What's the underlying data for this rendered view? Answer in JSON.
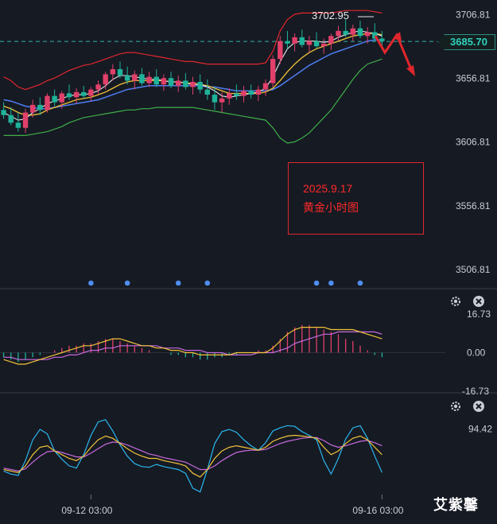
{
  "symbol_note": {
    "date": "2025.9.17",
    "text": "黄金小时图"
  },
  "watermark": "艾紫馨",
  "price_badge": "3685.70",
  "high_marker": "3702.95",
  "colors": {
    "up": "#e0406a",
    "down": "#1fb39a",
    "ma_fast": "#e8e8e8",
    "ma_mid": "#f2c33a",
    "ma_slow": "#4f7df2",
    "boll_upper": "#e0262d",
    "boll_lower": "#3fae4a",
    "macd_dif": "#f2c33a",
    "macd_dea": "#c86ae0",
    "kdj_k": "#f2c33a",
    "kdj_d": "#c86ae0",
    "kdj_j": "#2bb7f0",
    "annotation": "#ff2a2a",
    "dots": "#4f8df2"
  },
  "chart_data": [
    {
      "type": "candlestick",
      "title": "",
      "ylim": [
        3500,
        3712
      ],
      "y_ticks": [
        "3706.81",
        "3656.81",
        "3606.81",
        "3556.81",
        "3506.81"
      ],
      "y_tick_values": [
        3706.81,
        3656.81,
        3606.81,
        3556.81,
        3506.81
      ],
      "x_ticks": [
        "09-12 03:00",
        "09-16 03:00"
      ],
      "x_tick_index": [
        12,
        52
      ],
      "current_price": 3685.7,
      "high_marker": 3702.95,
      "candles": [
        [
          3632,
          3638,
          3625,
          3628
        ],
        [
          3628,
          3634,
          3620,
          3622
        ],
        [
          3622,
          3630,
          3615,
          3618
        ],
        [
          3618,
          3633,
          3614,
          3630
        ],
        [
          3630,
          3640,
          3626,
          3636
        ],
        [
          3636,
          3642,
          3628,
          3632
        ],
        [
          3632,
          3645,
          3630,
          3643
        ],
        [
          3643,
          3648,
          3635,
          3638
        ],
        [
          3638,
          3647,
          3633,
          3645
        ],
        [
          3645,
          3652,
          3640,
          3642
        ],
        [
          3642,
          3649,
          3637,
          3646
        ],
        [
          3646,
          3651,
          3641,
          3643
        ],
        [
          3643,
          3650,
          3639,
          3648
        ],
        [
          3648,
          3655,
          3644,
          3652
        ],
        [
          3652,
          3662,
          3648,
          3660
        ],
        [
          3660,
          3668,
          3655,
          3664
        ],
        [
          3664,
          3670,
          3657,
          3659
        ],
        [
          3659,
          3666,
          3652,
          3655
        ],
        [
          3655,
          3663,
          3648,
          3660
        ],
        [
          3660,
          3665,
          3651,
          3653
        ],
        [
          3653,
          3662,
          3650,
          3658
        ],
        [
          3658,
          3664,
          3650,
          3652
        ],
        [
          3652,
          3660,
          3647,
          3657
        ],
        [
          3657,
          3662,
          3649,
          3651
        ],
        [
          3651,
          3659,
          3646,
          3655
        ],
        [
          3655,
          3661,
          3648,
          3650
        ],
        [
          3650,
          3658,
          3644,
          3654
        ],
        [
          3654,
          3660,
          3645,
          3648
        ],
        [
          3648,
          3656,
          3640,
          3644
        ],
        [
          3644,
          3650,
          3632,
          3638
        ],
        [
          3638,
          3646,
          3630,
          3641
        ],
        [
          3641,
          3649,
          3636,
          3645
        ],
        [
          3645,
          3652,
          3640,
          3643
        ],
        [
          3643,
          3651,
          3638,
          3647
        ],
        [
          3647,
          3652,
          3641,
          3644
        ],
        [
          3644,
          3651,
          3639,
          3648
        ],
        [
          3648,
          3656,
          3643,
          3653
        ],
        [
          3653,
          3675,
          3650,
          3672
        ],
        [
          3672,
          3690,
          3668,
          3686
        ],
        [
          3686,
          3694,
          3680,
          3684
        ],
        [
          3684,
          3692,
          3678,
          3689
        ],
        [
          3689,
          3695,
          3681,
          3683
        ],
        [
          3683,
          3690,
          3677,
          3686
        ],
        [
          3686,
          3693,
          3680,
          3682
        ],
        [
          3682,
          3688,
          3676,
          3684
        ],
        [
          3684,
          3692,
          3679,
          3690
        ],
        [
          3690,
          3698,
          3686,
          3694
        ],
        [
          3694,
          3703,
          3689,
          3691
        ],
        [
          3691,
          3699,
          3686,
          3696
        ],
        [
          3696,
          3702,
          3688,
          3690
        ],
        [
          3690,
          3697,
          3684,
          3693
        ],
        [
          3693,
          3700,
          3686,
          3688
        ],
        [
          3688,
          3694,
          3681,
          3686
        ]
      ],
      "ma_fast": [
        3630,
        3627,
        3624,
        3625,
        3630,
        3633,
        3637,
        3639,
        3641,
        3643,
        3644,
        3644,
        3645,
        3647,
        3651,
        3656,
        3659,
        3659,
        3658,
        3657,
        3656,
        3656,
        3655,
        3654,
        3654,
        3653,
        3652,
        3652,
        3650,
        3647,
        3643,
        3642,
        3643,
        3644,
        3645,
        3646,
        3649,
        3658,
        3670,
        3680,
        3685,
        3686,
        3686,
        3686,
        3685,
        3686,
        3689,
        3691,
        3693,
        3694,
        3693,
        3692,
        3690
      ],
      "ma_mid": [
        3635,
        3633,
        3630,
        3628,
        3628,
        3629,
        3632,
        3634,
        3636,
        3638,
        3640,
        3641,
        3642,
        3644,
        3646,
        3649,
        3652,
        3654,
        3655,
        3655,
        3655,
        3655,
        3655,
        3654,
        3654,
        3653,
        3653,
        3652,
        3651,
        3649,
        3647,
        3645,
        3645,
        3645,
        3645,
        3645,
        3646,
        3649,
        3655,
        3662,
        3668,
        3673,
        3677,
        3680,
        3682,
        3684,
        3686,
        3688,
        3690,
        3691,
        3692,
        3692,
        3691
      ],
      "ma_slow": [
        3640,
        3639,
        3637,
        3635,
        3634,
        3633,
        3633,
        3634,
        3635,
        3636,
        3637,
        3638,
        3639,
        3640,
        3642,
        3644,
        3646,
        3648,
        3649,
        3650,
        3651,
        3651,
        3651,
        3651,
        3651,
        3651,
        3651,
        3651,
        3650,
        3650,
        3649,
        3648,
        3647,
        3647,
        3647,
        3647,
        3647,
        3648,
        3651,
        3655,
        3659,
        3663,
        3667,
        3670,
        3673,
        3676,
        3678,
        3680,
        3682,
        3684,
        3686,
        3687,
        3687
      ],
      "boll_upper": [
        3658,
        3655,
        3650,
        3648,
        3650,
        3652,
        3655,
        3657,
        3660,
        3663,
        3665,
        3667,
        3668,
        3670,
        3672,
        3674,
        3676,
        3677,
        3677,
        3676,
        3675,
        3674,
        3673,
        3672,
        3671,
        3670,
        3670,
        3669,
        3668,
        3668,
        3668,
        3668,
        3668,
        3668,
        3668,
        3668,
        3669,
        3678,
        3694,
        3703,
        3707,
        3708,
        3708,
        3708,
        3708,
        3708,
        3709,
        3710,
        3710,
        3710,
        3710,
        3709,
        3708
      ],
      "boll_lower": [
        3612,
        3612,
        3612,
        3612,
        3613,
        3614,
        3615,
        3617,
        3619,
        3622,
        3624,
        3626,
        3627,
        3628,
        3629,
        3630,
        3631,
        3632,
        3632,
        3633,
        3633,
        3634,
        3634,
        3634,
        3634,
        3634,
        3634,
        3633,
        3632,
        3631,
        3630,
        3629,
        3628,
        3627,
        3626,
        3625,
        3624,
        3618,
        3610,
        3606,
        3607,
        3610,
        3614,
        3620,
        3626,
        3632,
        3640,
        3648,
        3656,
        3663,
        3668,
        3670,
        3672
      ],
      "markers": {
        "dot_positions_index": [
          12,
          17,
          24,
          28,
          43,
          45,
          49
        ]
      }
    },
    {
      "type": "bar",
      "title": "",
      "name": "MACD",
      "ylim": [
        -16.73,
        16.73
      ],
      "y_ticks": [
        "16.73",
        "0.00",
        "-16.73"
      ],
      "y_tick_values": [
        16.73,
        0.0,
        -16.73
      ],
      "histogram": [
        -2,
        -3,
        -4,
        -3,
        -2,
        -1,
        0,
        1,
        2,
        3,
        3,
        4,
        4,
        5,
        6,
        6,
        5,
        4,
        3,
        2,
        1,
        0,
        0,
        -1,
        -1,
        -2,
        -2,
        -3,
        -3,
        -2,
        -2,
        -1,
        -1,
        0,
        0,
        1,
        1,
        3,
        6,
        9,
        11,
        12,
        12,
        11,
        10,
        9,
        8,
        6,
        5,
        3,
        1,
        -1,
        -2
      ],
      "dif": [
        -3,
        -4,
        -5,
        -5,
        -4,
        -3,
        -2,
        -1,
        0,
        1,
        2,
        3,
        3,
        4,
        5,
        6,
        6,
        5,
        4,
        3,
        3,
        2,
        2,
        1,
        1,
        0,
        0,
        -1,
        -1,
        -1,
        -1,
        -1,
        0,
        0,
        0,
        0,
        0,
        2,
        5,
        8,
        10,
        11,
        11,
        11,
        11,
        10,
        10,
        10,
        10,
        9,
        8,
        7,
        6
      ],
      "dea": [
        -2,
        -2,
        -3,
        -3,
        -3,
        -3,
        -3,
        -2,
        -2,
        -1,
        -1,
        0,
        1,
        1,
        2,
        2,
        3,
        3,
        3,
        3,
        3,
        3,
        2,
        2,
        2,
        1,
        1,
        1,
        0,
        0,
        0,
        -1,
        -1,
        -1,
        -1,
        0,
        0,
        0,
        1,
        2,
        4,
        5,
        6,
        7,
        8,
        8,
        9,
        9,
        9,
        9,
        9,
        9,
        8
      ]
    },
    {
      "type": "line",
      "title": "",
      "name": "KDJ",
      "ylim": [
        0,
        110
      ],
      "y_ticks": [
        "94.42"
      ],
      "y_tick_values": [
        94.42
      ],
      "k": [
        40,
        38,
        36,
        45,
        60,
        70,
        72,
        65,
        60,
        55,
        52,
        58,
        70,
        80,
        85,
        82,
        75,
        68,
        62,
        58,
        55,
        55,
        52,
        50,
        48,
        45,
        35,
        30,
        40,
        55,
        65,
        70,
        72,
        70,
        68,
        66,
        70,
        78,
        82,
        85,
        86,
        85,
        84,
        82,
        70,
        60,
        65,
        75,
        82,
        85,
        80,
        70,
        60
      ],
      "d": [
        42,
        40,
        38,
        41,
        50,
        58,
        64,
        65,
        63,
        60,
        57,
        57,
        62,
        68,
        74,
        77,
        76,
        73,
        69,
        65,
        61,
        59,
        56,
        54,
        52,
        50,
        45,
        40,
        40,
        45,
        52,
        58,
        63,
        65,
        66,
        66,
        67,
        71,
        75,
        78,
        80,
        82,
        83,
        83,
        79,
        73,
        70,
        72,
        75,
        78,
        79,
        76,
        72
      ],
      "j": [
        38,
        34,
        32,
        52,
        80,
        94,
        88,
        65,
        54,
        45,
        42,
        60,
        86,
        104,
        107,
        92,
        73,
        58,
        48,
        44,
        43,
        47,
        44,
        42,
        40,
        35,
        15,
        10,
        40,
        75,
        91,
        94,
        90,
        80,
        72,
        66,
        76,
        92,
        96,
        99,
        98,
        91,
        86,
        80,
        52,
        34,
        55,
        81,
        96,
        99,
        82,
        58,
        36
      ]
    }
  ]
}
